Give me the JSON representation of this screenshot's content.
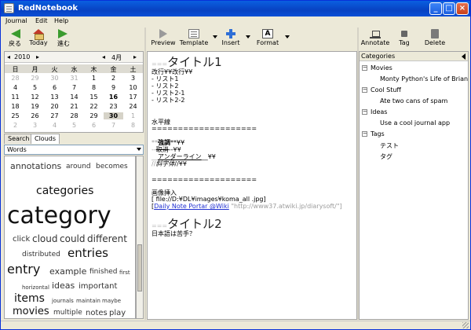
{
  "window": {
    "title": "RedNotebook"
  },
  "menu": [
    "Journal",
    "Edit",
    "Help"
  ],
  "left_toolbar": [
    {
      "label": "戻る",
      "icon": "back-arrow-icon"
    },
    {
      "label": "Today",
      "icon": "home-icon"
    },
    {
      "label": "進む",
      "icon": "forward-arrow-icon"
    }
  ],
  "calendar": {
    "year": "2010",
    "month": "4月",
    "weekdays": [
      "日",
      "月",
      "火",
      "水",
      "木",
      "金",
      "土"
    ],
    "weeks": [
      [
        "28",
        "29",
        "30",
        "31",
        "1",
        "2",
        "3"
      ],
      [
        "4",
        "5",
        "6",
        "7",
        "8",
        "9",
        "10"
      ],
      [
        "11",
        "12",
        "13",
        "14",
        "15",
        "16",
        "17"
      ],
      [
        "18",
        "19",
        "20",
        "21",
        "22",
        "23",
        "24"
      ],
      [
        "25",
        "26",
        "27",
        "28",
        "29",
        "30",
        "1"
      ],
      [
        "2",
        "3",
        "4",
        "5",
        "6",
        "7",
        "8"
      ]
    ],
    "selected_day": "30",
    "bold_day": "16"
  },
  "left_tabs": {
    "search": "Search",
    "clouds": "Clouds"
  },
  "cloud_select": {
    "value": "Words"
  },
  "cloud_words": [
    "annotations",
    "around",
    "becomes",
    "categories",
    "category",
    "click",
    "cloud",
    "could",
    "different",
    "distributed",
    "entries",
    "entry",
    "example",
    "finished",
    "first",
    "horizontal",
    "ideas",
    "important",
    "items",
    "journals",
    "maintain",
    "maybe",
    "movies",
    "multiple",
    "notes",
    "play"
  ],
  "center_toolbar": {
    "preview": "Preview",
    "template": "Template",
    "insert": "Insert",
    "format": "Format"
  },
  "editor": {
    "heading_marks": "===",
    "h1_text": "タイトル1",
    "line_breaks": "改行¥¥改行¥¥",
    "list1": "- リスト1",
    "list2": "- リスト2",
    "list21": " - リスト2-1",
    "list22": " - リスト2-2",
    "hr_label": "水平線",
    "hr": "====================",
    "bold_pre": "**",
    "bold_text": "強調",
    "bold_post": "**¥¥",
    "strike_pre": "--",
    "strike_text": "取消",
    "strike_post": "--¥¥",
    "under_pre": "__",
    "under_text": "アンダーライン",
    "under_post": "__¥¥",
    "italic_pre": "//",
    "italic_text": "斜字体",
    "italic_post": "//¥¥",
    "hr2": "====================",
    "img_label": "画像挿入",
    "img_path": "[  file://D:¥DL¥images¥koma_all  .jpg]",
    "link_text": "Daily Note Portar @Wiki",
    "link_url": " \"http://www37.atwiki.jp/diarysoft/\"]",
    "link_open": "[",
    "h2_text": "タイトル2",
    "last_line": "日本語は苦手？"
  },
  "right_toolbar": {
    "annotate": "Annotate",
    "tag": "Tag",
    "delete": "Delete"
  },
  "tree": {
    "header": "Categories",
    "nodes": [
      {
        "label": "Movies",
        "children": [
          "Monty Python's Life of Brian"
        ]
      },
      {
        "label": "Cool Stuff",
        "children": [
          "Ate two cans of spam"
        ]
      },
      {
        "label": "Ideas",
        "children": [
          "Use a cool journal app"
        ]
      },
      {
        "label": "Tags",
        "children": [
          "テスト",
          "タグ"
        ]
      }
    ]
  }
}
